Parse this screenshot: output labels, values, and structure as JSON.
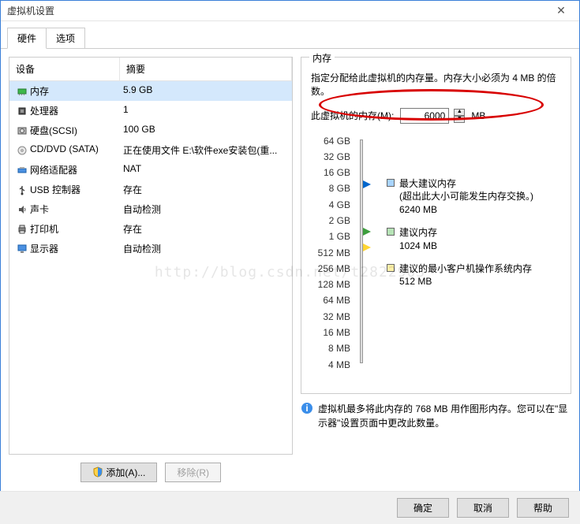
{
  "window": {
    "title": "虚拟机设置"
  },
  "tabs": [
    "硬件",
    "选项"
  ],
  "active_tab": 0,
  "device_list": {
    "col_device": "设备",
    "col_summary": "摘要",
    "rows": [
      {
        "icon": "memory",
        "name": "内存",
        "summary": "5.9 GB",
        "selected": true
      },
      {
        "icon": "cpu",
        "name": "处理器",
        "summary": "1"
      },
      {
        "icon": "hdd",
        "name": "硬盘(SCSI)",
        "summary": "100 GB"
      },
      {
        "icon": "disc",
        "name": "CD/DVD (SATA)",
        "summary": "正在使用文件 E:\\软件exe安装包(重..."
      },
      {
        "icon": "net",
        "name": "网络适配器",
        "summary": "NAT"
      },
      {
        "icon": "usb",
        "name": "USB 控制器",
        "summary": "存在"
      },
      {
        "icon": "sound",
        "name": "声卡",
        "summary": "自动检测"
      },
      {
        "icon": "printer",
        "name": "打印机",
        "summary": "存在"
      },
      {
        "icon": "display",
        "name": "显示器",
        "summary": "自动检测"
      }
    ]
  },
  "left_buttons": {
    "add": "添加(A)...",
    "remove": "移除(R)"
  },
  "memory_group": {
    "title": "内存",
    "desc": "指定分配给此虚拟机的内存量。内存大小必须为 4 MB 的倍数。",
    "label": "此虚拟机的内存(M):",
    "value": "6000",
    "unit": "MB",
    "ticks": [
      "64 GB",
      "32 GB",
      "16 GB",
      "8 GB",
      "4 GB",
      "2 GB",
      "1 GB",
      "512 MB",
      "256 MB",
      "128 MB",
      "64 MB",
      "32 MB",
      "16 MB",
      "8 MB",
      "4 MB"
    ],
    "legends": [
      {
        "color": "blue",
        "title": "最大建议内存",
        "note": "(超出此大小可能发生内存交换。)",
        "value": "6240 MB"
      },
      {
        "color": "green",
        "title": "建议内存",
        "note": "",
        "value": "1024 MB"
      },
      {
        "color": "yellow",
        "title": "建议的最小客户机操作系统内存",
        "note": "",
        "value": "512 MB"
      }
    ],
    "info": "虚拟机最多将此内存的 768 MB 用作图形内存。您可以在\"显示器\"设置页面中更改此数量。"
  },
  "footer": {
    "ok": "确定",
    "cancel": "取消",
    "help": "帮助"
  },
  "watermark": "http://blog.csdn.net/t2822903"
}
